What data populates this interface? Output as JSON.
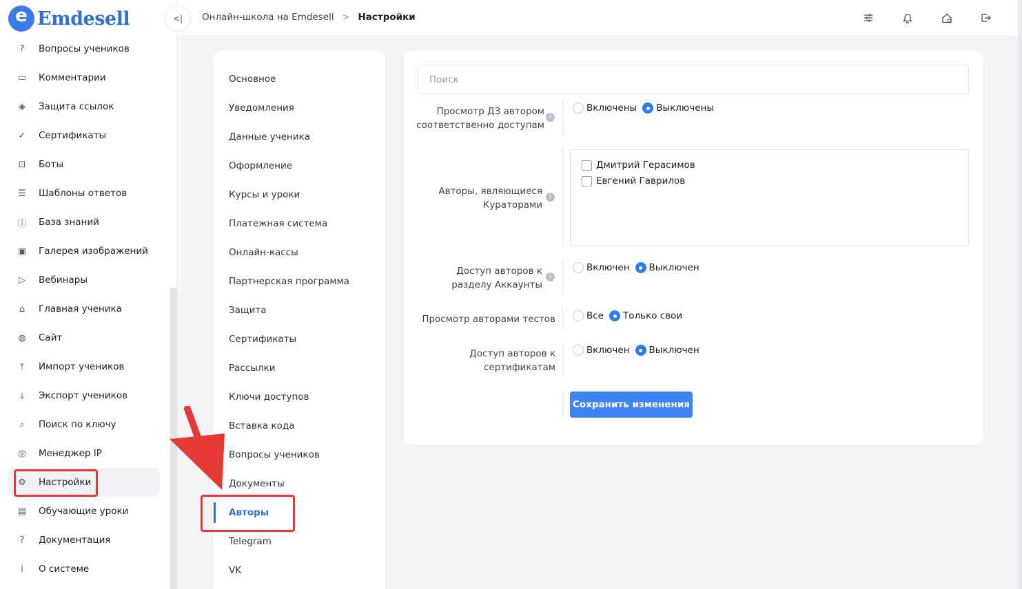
{
  "app": {
    "logo_text": "Emdesell",
    "logo_letter": "e"
  },
  "sidebar": {
    "items": [
      {
        "label": "Вопросы учеников",
        "icon": "question-circle-icon",
        "glyph": "?"
      },
      {
        "label": "Комментарии",
        "icon": "comment-icon",
        "glyph": "▭"
      },
      {
        "label": "Защита ссылок",
        "icon": "shield-icon",
        "glyph": "◈"
      },
      {
        "label": "Сертификаты",
        "icon": "certificate-check-icon",
        "glyph": "✓"
      },
      {
        "label": "Боты",
        "icon": "bot-icon",
        "glyph": "⊡"
      },
      {
        "label": "Шаблоны ответов",
        "icon": "list-icon",
        "glyph": "☰"
      },
      {
        "label": "База знаний",
        "icon": "info-circle-icon",
        "glyph": "ⓘ"
      },
      {
        "label": "Галерея изображений",
        "icon": "image-icon",
        "glyph": "▣"
      },
      {
        "label": "Вебинары",
        "icon": "play-icon",
        "glyph": "▷"
      },
      {
        "label": "Главная ученика",
        "icon": "home-icon",
        "glyph": "⌂"
      },
      {
        "label": "Сайт",
        "icon": "globe-icon",
        "glyph": "◍"
      },
      {
        "label": "Импорт учеников",
        "icon": "upload-icon",
        "glyph": "⤒"
      },
      {
        "label": "Экспорт учеников",
        "icon": "download-icon",
        "glyph": "⤓"
      },
      {
        "label": "Поиск по ключу",
        "icon": "search-icon",
        "glyph": "⌕"
      },
      {
        "label": "Менеджер IP",
        "icon": "target-icon",
        "glyph": "◎"
      },
      {
        "label": "Настройки",
        "icon": "gear-icon",
        "glyph": "⚙"
      },
      {
        "label": "Обучающие уроки",
        "icon": "film-icon",
        "glyph": "▤"
      },
      {
        "label": "Документация",
        "icon": "help-square-icon",
        "glyph": "?"
      },
      {
        "label": "О системе",
        "icon": "info-square-icon",
        "glyph": "i"
      }
    ],
    "active_index": 15
  },
  "topbar": {
    "collapse_glyph": "<|",
    "breadcrumb_root": "Онлайн-школа на Emdesell",
    "breadcrumb_sep": ">",
    "breadcrumb_current": "Настройки",
    "icons": [
      "sliders-icon",
      "bell-icon",
      "home-settings-icon",
      "logout-icon"
    ]
  },
  "submenu": {
    "items": [
      "Основное",
      "Уведомления",
      "Данные ученика",
      "Оформление",
      "Курсы и уроки",
      "Платежная система",
      "Онлайн-кассы",
      "Партнерская программа",
      "Защита",
      "Сертификаты",
      "Рассылки",
      "Ключи доступов",
      "Вставка кода",
      "Вопросы учеников",
      "Документы",
      "Авторы",
      "Telegram",
      "VK"
    ],
    "active_index": 15
  },
  "form": {
    "search_placeholder": "Поиск",
    "hw_view": {
      "label_line1": "Просмотр ДЗ автором",
      "label_line2": "соответственно доступам",
      "options": [
        "Включены",
        "Выключены"
      ],
      "selected": "Выключены"
    },
    "curators": {
      "label_line1": "Авторы, являющиеся",
      "label_line2": "Кураторами",
      "authors": [
        {
          "name": "Дмитрий Герасимов",
          "checked": false
        },
        {
          "name": "Евгений Гаврилов",
          "checked": false
        }
      ]
    },
    "accounts_access": {
      "label_line1": "Доступ авторов к",
      "label_line2": "разделу Аккаунты",
      "options": [
        "Включен",
        "Выключен"
      ],
      "selected": "Выключен"
    },
    "tests_view": {
      "label": "Просмотр авторами тестов",
      "options": [
        "Все",
        "Только свои"
      ],
      "selected": "Только свои"
    },
    "certs_access": {
      "label_line1": "Доступ авторов к",
      "label_line2": "сертификатам",
      "options": [
        "Включен",
        "Выключен"
      ],
      "selected": "Выключен"
    },
    "save_label": "Сохранить изменения",
    "info_glyph": "i"
  },
  "colors": {
    "accent": "#2f7cf2",
    "annotation": "#e53935",
    "logo": "#2f6fd8"
  }
}
